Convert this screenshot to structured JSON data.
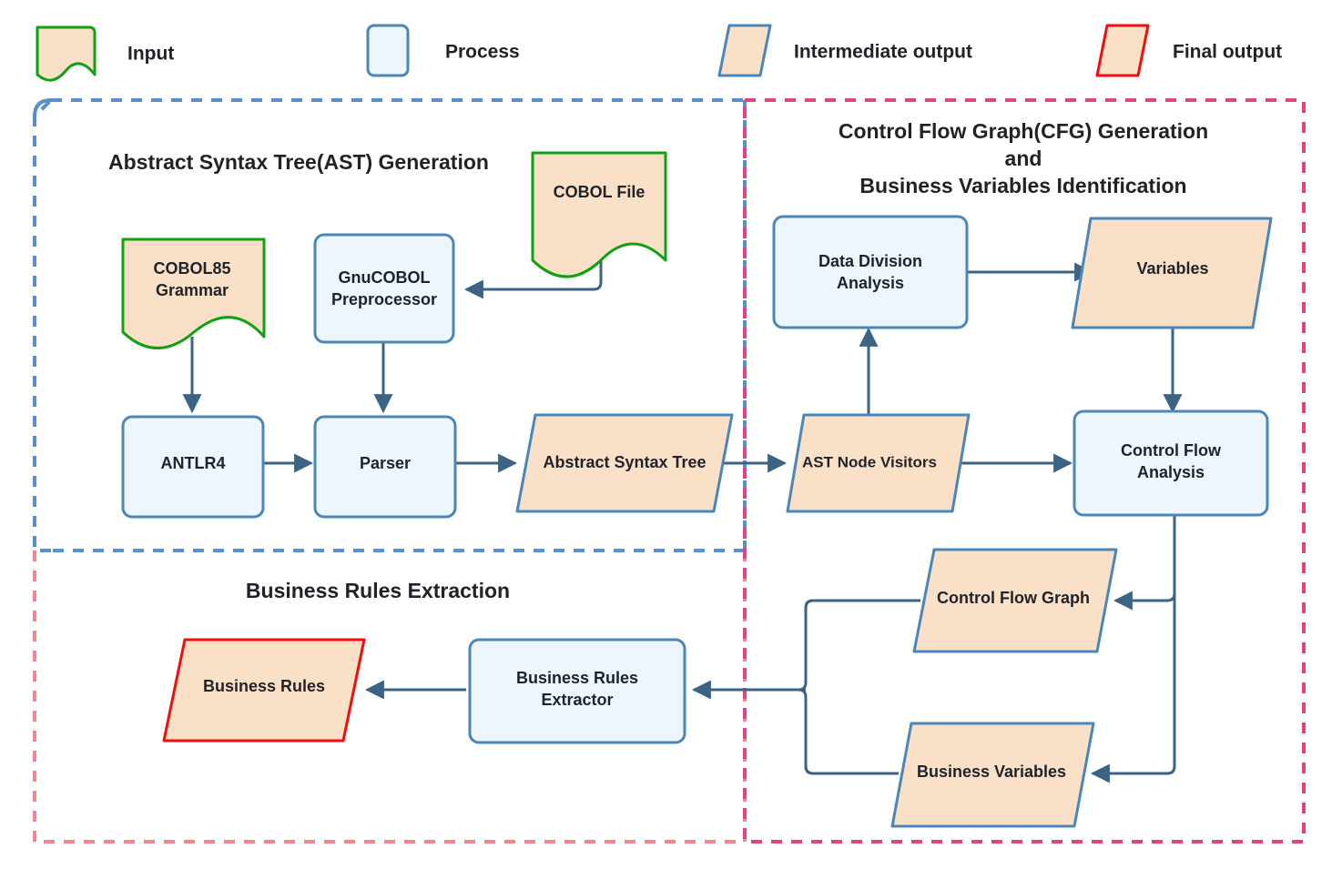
{
  "colors": {
    "process_fill": "#eef6fd",
    "process_stroke": "#4a86b8",
    "output_fill": "#fbe0c8",
    "input_stroke": "#11a011",
    "final_stroke": "#fa0a0a",
    "edge": "#3b6383",
    "region_ast_stroke": "#5b8fc9",
    "region_rules_stroke": "#f2868f",
    "region_cfg_stroke": "#e0457f",
    "text": "#1f2328"
  },
  "legend": {
    "items": [
      {
        "label": "Input",
        "shape": "document",
        "stroke": "#11a011",
        "fill": "#fbe0c8"
      },
      {
        "label": "Process",
        "shape": "rounded-rect",
        "stroke": "#4a86b8",
        "fill": "#eef6fd"
      },
      {
        "label": "Intermediate output",
        "shape": "parallelogram",
        "stroke": "#4a86b8",
        "fill": "#fbe0c8"
      },
      {
        "label": "Final output",
        "shape": "parallelogram",
        "stroke": "#fa0a0a",
        "fill": "#fbe0c8"
      }
    ]
  },
  "regions": {
    "ast": {
      "title": "Abstract Syntax Tree(AST) Generation"
    },
    "cfg": {
      "title_line1": "Control Flow Graph(CFG) Generation",
      "title_line2": "and",
      "title_line3": "Business Variables Identification"
    },
    "rules": {
      "title": "Business Rules Extraction"
    }
  },
  "nodes": {
    "cobol_file": {
      "label": "COBOL File",
      "type": "input"
    },
    "cobol85_grammar_l1": {
      "label": "COBOL85",
      "type": "input"
    },
    "cobol85_grammar_l2": {
      "label": "Grammar",
      "type": "input"
    },
    "gnucobol_l1": {
      "label": "GnuCOBOL",
      "type": "process"
    },
    "gnucobol_l2": {
      "label": "Preprocessor",
      "type": "process"
    },
    "antlr4": {
      "label": "ANTLR4",
      "type": "process"
    },
    "parser": {
      "label": "Parser",
      "type": "process"
    },
    "abstract_syntax_tree": {
      "label": "Abstract Syntax Tree",
      "type": "intermediate"
    },
    "ast_node_visitors": {
      "label": "AST  Node Visitors",
      "type": "intermediate"
    },
    "data_division_l1": {
      "label": "Data Division",
      "type": "process"
    },
    "data_division_l2": {
      "label": "Analysis",
      "type": "process"
    },
    "variables": {
      "label": "Variables",
      "type": "intermediate"
    },
    "control_flow_analysis_l1": {
      "label": "Control Flow",
      "type": "process"
    },
    "control_flow_analysis_l2": {
      "label": "Analysis",
      "type": "process"
    },
    "control_flow_graph": {
      "label": "Control Flow Graph",
      "type": "intermediate"
    },
    "business_variables": {
      "label": "Business Variables",
      "type": "intermediate"
    },
    "business_rules_extractor_l1": {
      "label": "Business Rules",
      "type": "process"
    },
    "business_rules_extractor_l2": {
      "label": "Extractor",
      "type": "process"
    },
    "business_rules": {
      "label": "Business Rules",
      "type": "final"
    }
  }
}
